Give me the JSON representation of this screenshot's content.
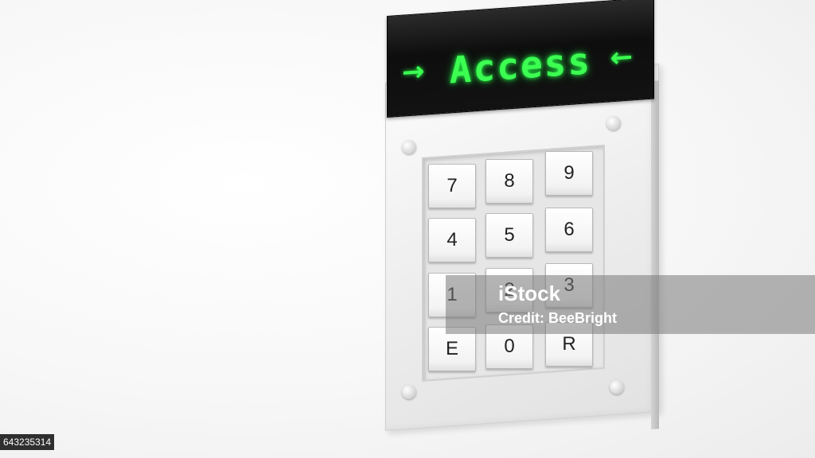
{
  "display": {
    "text": "Access",
    "left_arrow": "→",
    "right_arrow": "←",
    "led_color": "#3cff52"
  },
  "keypad": {
    "keys": [
      "7",
      "8",
      "9",
      "4",
      "5",
      "6",
      "1",
      "2",
      "3",
      "E",
      "0",
      "R"
    ]
  },
  "watermark": {
    "logo": "iStock",
    "credit": "Credit: BeeBright"
  },
  "image_id": "643235314"
}
